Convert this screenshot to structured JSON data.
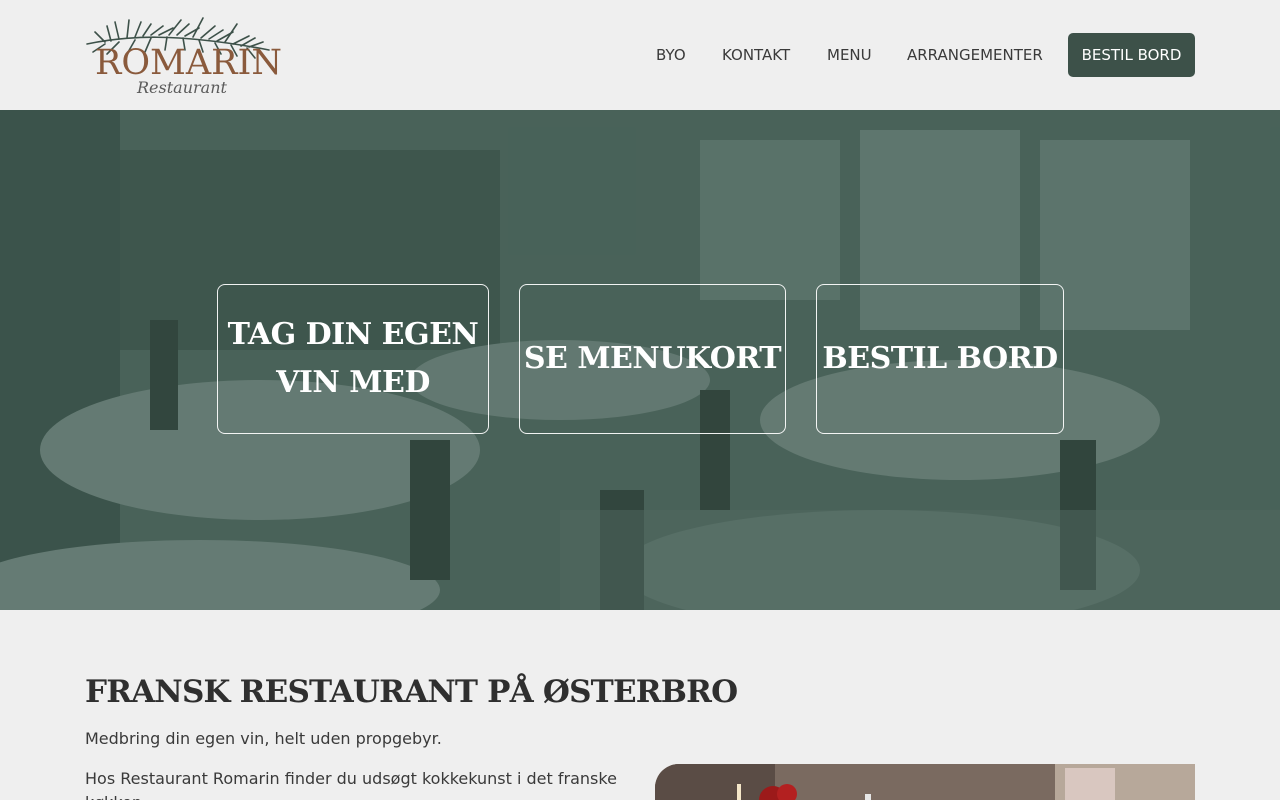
{
  "header": {
    "logo_name": "ROMARIN",
    "logo_sub": "Restaurant",
    "nav": {
      "byo": "BYO",
      "kontakt": "KONTAKT",
      "menu": "MENU",
      "arrangementer": "ARRANGEMENTER"
    },
    "cta_label": "BESTIL BORD"
  },
  "colors": {
    "background": "#efefef",
    "accent": "#3d5149",
    "logo_brown": "#8a5a3c",
    "hero_overlay": "#345248"
  },
  "hero": {
    "cards": [
      {
        "line1": "TAG DIN EGEN",
        "line2": "VIN MED"
      },
      {
        "line1": "SE MENUKORT"
      },
      {
        "line1": "BESTIL BORD"
      }
    ]
  },
  "content": {
    "title": "FRANSK RESTAURANT PÅ ØSTERBRO",
    "intro": "Medbring din egen vin, helt uden propgebyr.",
    "body": "Hos Restaurant Romarin finder du udsøgt kokkekunst i det franske køkken."
  }
}
